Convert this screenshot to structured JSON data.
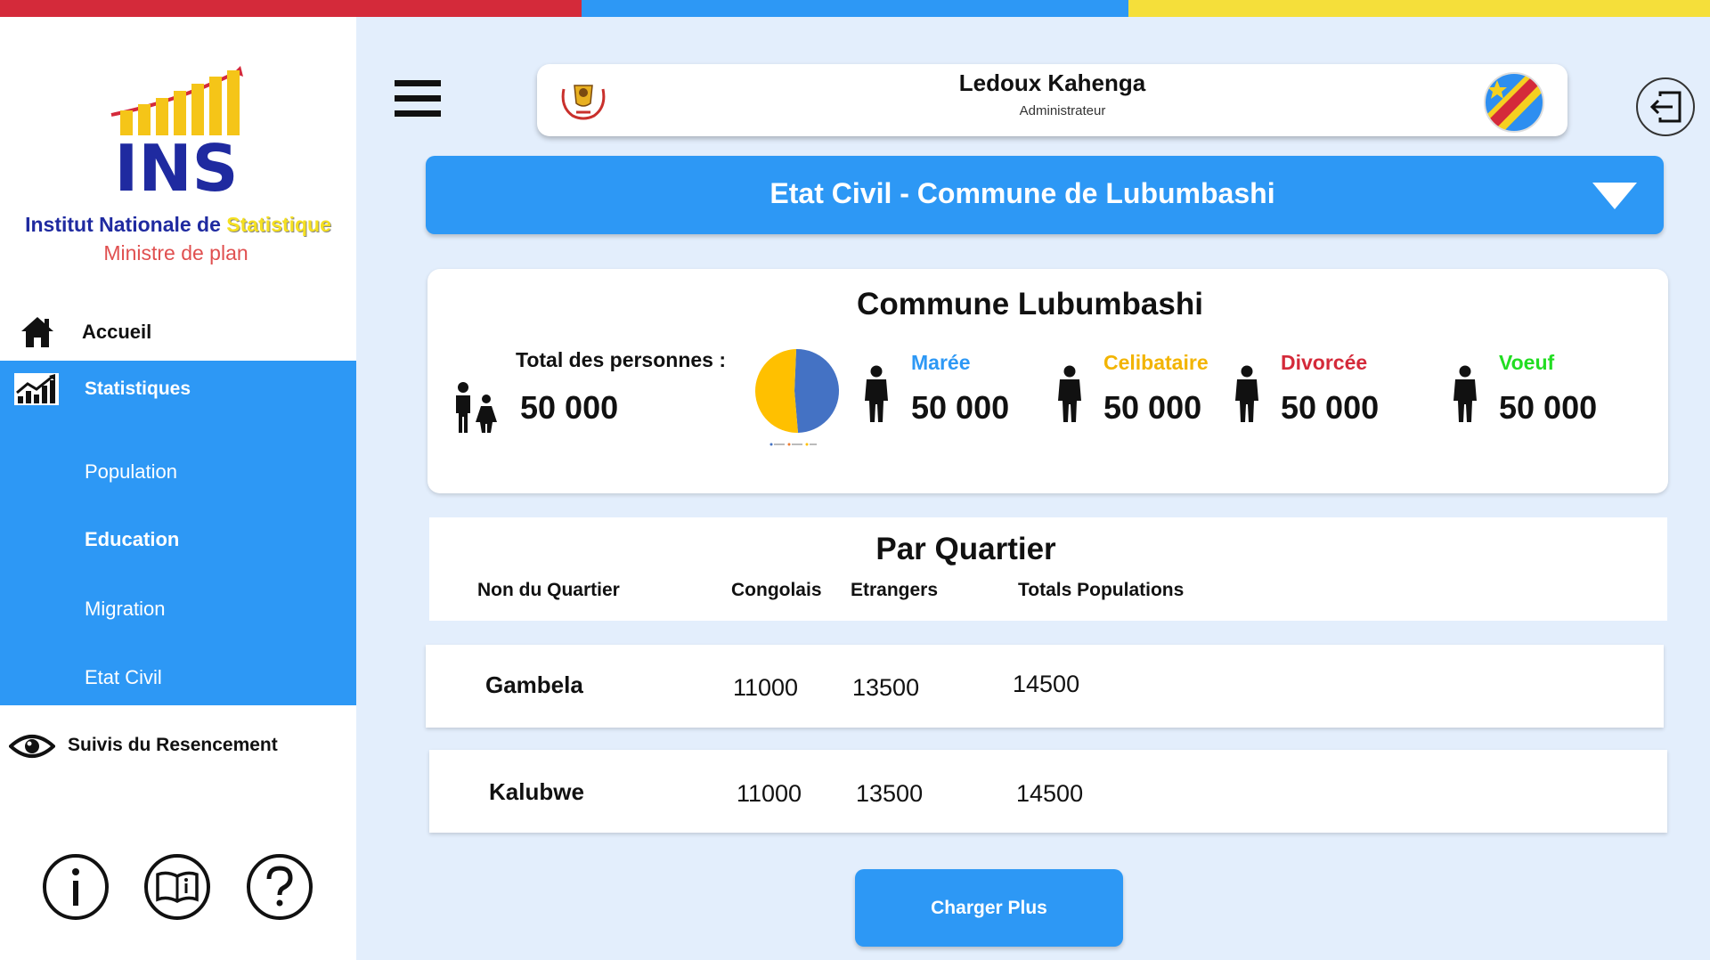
{
  "brand": {
    "logo_text": "INS",
    "name_prefix": "Institut Nationale de ",
    "name_highlight": "Statistique",
    "subtitle": "Ministre de plan"
  },
  "sidebar": {
    "home_label": "Accueil",
    "stats_label": "Statistiques",
    "sub_items": [
      "Population",
      "Education",
      "Migration",
      "Etat Civil"
    ],
    "suivis_label": "Suivis du Resencement"
  },
  "header": {
    "user_name": "Ledoux Kahenga",
    "user_role": "Administrateur"
  },
  "title_bar": {
    "title": "Etat Civil - Commune de Lubumbashi"
  },
  "summary": {
    "title": "Commune Lubumbashi",
    "total_label": "Total des personnes :",
    "total_value": "50 000",
    "stats": [
      {
        "label": "Marée",
        "value": "50 000",
        "color": "#2d98f5"
      },
      {
        "label": "Celibataire",
        "value": "50 000",
        "color": "#f2b400"
      },
      {
        "label": "Divorcée",
        "value": "50 000",
        "color": "#d42a3a"
      },
      {
        "label": "Voeuf",
        "value": "50 000",
        "color": "#22dd22"
      }
    ]
  },
  "table": {
    "title": "Par Quartier",
    "columns": [
      "Non du Quartier",
      "Congolais",
      "Etrangers",
      "Totals Populations"
    ],
    "rows": [
      {
        "name": "Gambela",
        "congolais": "11000",
        "etrangers": "13500",
        "total": "14500"
      },
      {
        "name": "Kalubwe",
        "congolais": "11000",
        "etrangers": "13500",
        "total": "14500"
      }
    ]
  },
  "load_more_label": "Charger Plus",
  "colors": {
    "primary": "#2d98f5",
    "flag_red": "#d42a3a",
    "flag_yellow": "#f5df3a",
    "page_bg": "#e3eefc",
    "pie_blue": "#4472c4",
    "pie_yellow": "#ffc000"
  }
}
